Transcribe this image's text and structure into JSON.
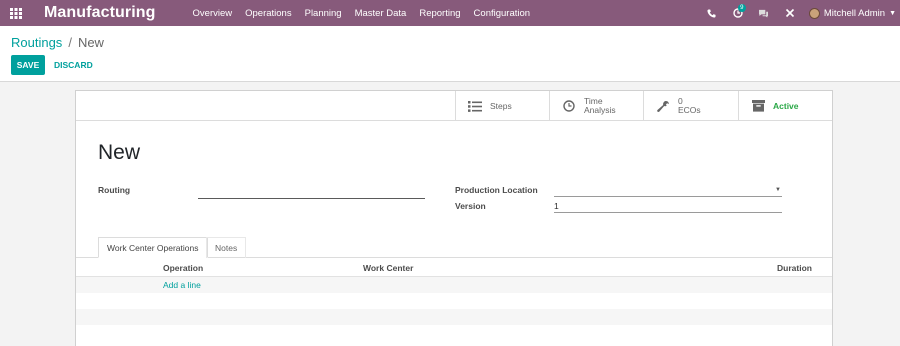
{
  "app": {
    "name": "Manufacturing",
    "menu": [
      "Overview",
      "Operations",
      "Planning",
      "Master Data",
      "Reporting",
      "Configuration"
    ]
  },
  "topbar": {
    "icons": [
      "phone-icon",
      "activity-icon",
      "chat-icon",
      "debug-icon"
    ],
    "activity_badge": "9",
    "user_name": "Mitchell Admin"
  },
  "breadcrumb": {
    "parent": "Routings",
    "separator": "/",
    "current": "New"
  },
  "buttons": {
    "save": "SAVE",
    "discard": "DISCARD"
  },
  "smart_buttons": {
    "steps": "Steps",
    "time_analysis_line1": "Time",
    "time_analysis_line2": "Analysis",
    "ecos_count": "0",
    "ecos_label": "ECOs",
    "active": "Active"
  },
  "form": {
    "title": "New",
    "routing_label": "Routing",
    "routing_value": "",
    "production_location_label": "Production Location",
    "production_location_value": "",
    "version_label": "Version",
    "version_value": "1"
  },
  "tabs": [
    "Work Center Operations",
    "Notes"
  ],
  "table": {
    "columns": [
      "Operation",
      "Work Center",
      "Duration"
    ],
    "add_line": "Add a line"
  },
  "colors": {
    "navbar": "#875a7b",
    "primary": "#00a09d",
    "active_status": "#28a745"
  }
}
